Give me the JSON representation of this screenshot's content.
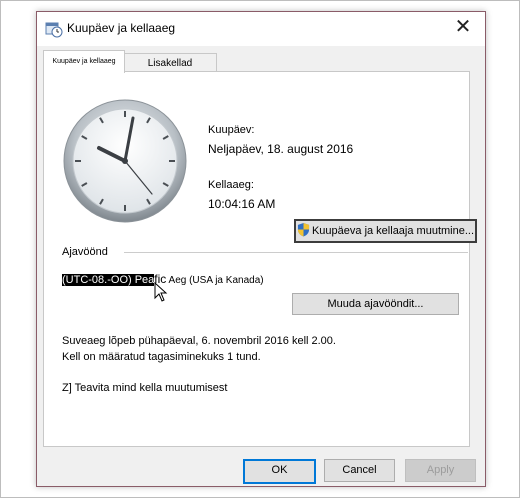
{
  "window": {
    "title": "Kuupäev ja kellaaeg",
    "close_glyph": "✕"
  },
  "tabs": [
    {
      "label": "Kuupäev ja kellaaeg",
      "active": true
    },
    {
      "label": "Lisakellad",
      "active": false
    }
  ],
  "date": {
    "label": "Kuupäev:",
    "value": "Neljapäev, 18. august 2016"
  },
  "time": {
    "label": "Kellaaeg:",
    "value": "10:04:16 AM"
  },
  "buttons": {
    "change_datetime": "Kuupäeva ja kellaaja muutmine...",
    "change_timezone": "Muuda ajavööndit..."
  },
  "timezone": {
    "section_label": "Ajavöönd",
    "value_highlighted": "(UTC-08.-OO) Pea",
    "value_mid": "fic",
    "value_rest": " Aeg (USA ja Kanada)"
  },
  "dst": {
    "line1": "Suveaeg lõpeb pühapäeval, 6. novembril 2016 kell 2.00.",
    "line2": "Kell on määratud tagasiminekuks 1 tund."
  },
  "notify": "Z] Teavita mind kella muutumisest",
  "footer": {
    "ok": "OK",
    "cancel": "Cancel",
    "apply": "Apply"
  },
  "icons": {
    "title": "calendar-clock-icon",
    "shield": "uac-shield-icon",
    "cursor": "mouse-pointer-icon",
    "clock": "analog-clock-icon"
  },
  "colors": {
    "dialog_border": "#8a5c68",
    "ok_focus": "#0078d7",
    "highlight": "#000000"
  }
}
